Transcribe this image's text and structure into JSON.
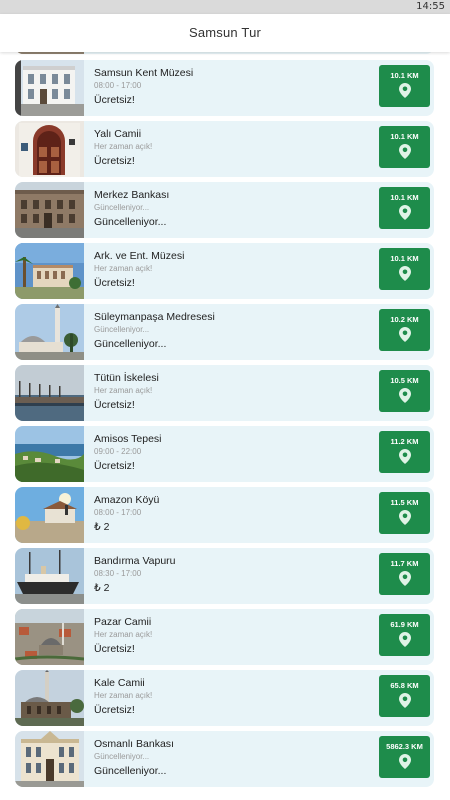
{
  "status": {
    "time": "14:55"
  },
  "app": {
    "title": "Samsun Tur"
  },
  "places": [
    {
      "name": "Samsun Kent Müzesi",
      "hours": "08:00 - 17:00",
      "price": "Ücretsiz!",
      "distance": "10.1 KM",
      "thumb": "museum-building"
    },
    {
      "name": "Yalı Camii",
      "hours": "Her zaman açık!",
      "price": "Ücretsiz!",
      "distance": "10.1 KM",
      "thumb": "mosque-door"
    },
    {
      "name": "Merkez Bankası",
      "hours": "Güncelleniyor...",
      "price": "Güncelleniyor...",
      "distance": "10.1 KM",
      "thumb": "stone-building"
    },
    {
      "name": "Ark. ve Ent. Müzesi",
      "hours": "Her zaman açık!",
      "price": "Ücretsiz!",
      "distance": "10.1 KM",
      "thumb": "museum-palms"
    },
    {
      "name": "Süleymanpaşa Medresesi",
      "hours": "Güncelleniyor...",
      "price": "Güncelleniyor...",
      "distance": "10.2 KM",
      "thumb": "minaret"
    },
    {
      "name": "Tütün İskelesi",
      "hours": "Her zaman açık!",
      "price": "Ücretsiz!",
      "distance": "10.5 KM",
      "thumb": "pier"
    },
    {
      "name": "Amisos Tepesi",
      "hours": "09:00 - 22:00",
      "price": "Ücretsiz!",
      "distance": "11.2 KM",
      "thumb": "hill-sea"
    },
    {
      "name": "Amazon Köyü",
      "hours": "08:00 - 17:00",
      "price": "₺ 2",
      "distance": "11.5 KM",
      "thumb": "amazon-village"
    },
    {
      "name": "Bandırma Vapuru",
      "hours": "08:30 - 17:00",
      "price": "₺ 2",
      "distance": "11.7 KM",
      "thumb": "ship"
    },
    {
      "name": "Pazar Camii",
      "hours": "Her zaman açık!",
      "price": "Ücretsiz!",
      "distance": "61.9 KM",
      "thumb": "aerial-mosque"
    },
    {
      "name": "Kale Camii",
      "hours": "Her zaman açık!",
      "price": "Ücretsiz!",
      "distance": "65.8 KM",
      "thumb": "castle-mosque"
    },
    {
      "name": "Osmanlı Bankası",
      "hours": "Güncelleniyor...",
      "price": "Güncelleniyor...",
      "distance": "5862.3 KM",
      "thumb": "bank-building"
    }
  ],
  "colors": {
    "accent": "#1e8c4b",
    "card": "#e8f4f8"
  }
}
